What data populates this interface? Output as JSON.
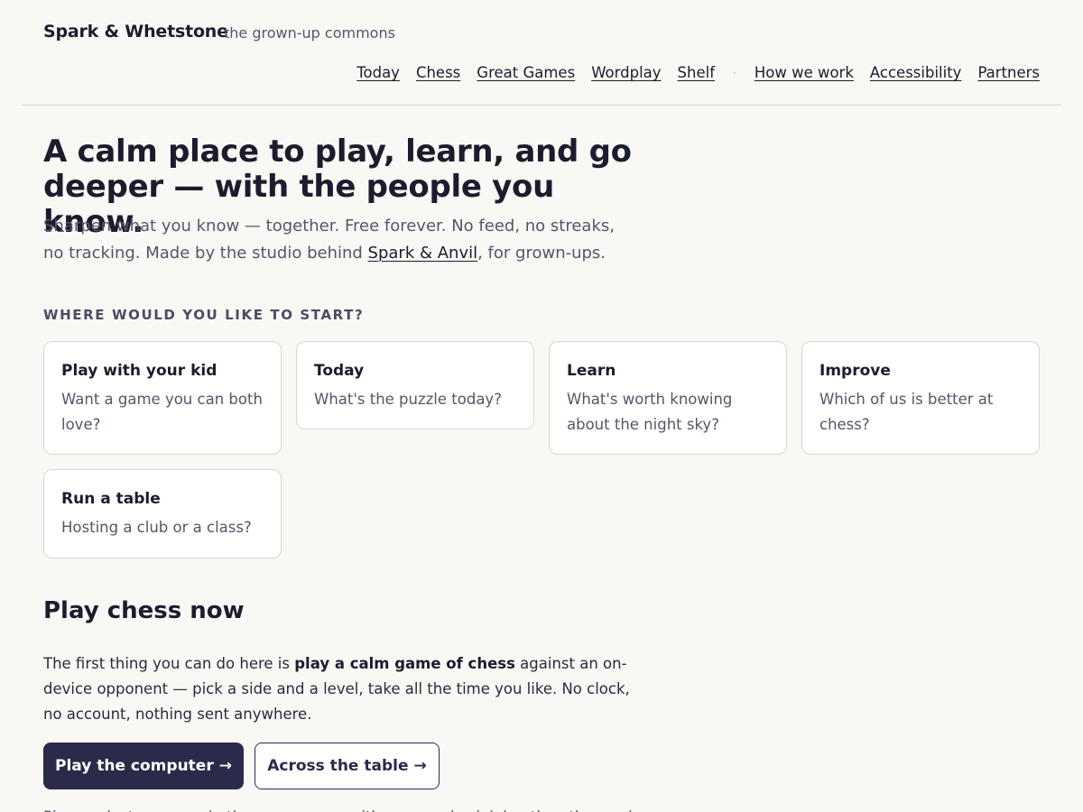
{
  "header": {
    "brand": "Spark & Whetstone",
    "tagline": "the grown-up commons",
    "nav": [
      {
        "label": "Today"
      },
      {
        "label": "Chess"
      },
      {
        "label": "Great Games"
      },
      {
        "label": "Wordplay"
      },
      {
        "label": "Shelf"
      }
    ],
    "nav_separator": "·",
    "nav_secondary": [
      {
        "label": "How we work"
      },
      {
        "label": "Accessibility"
      },
      {
        "label": "Partners"
      }
    ]
  },
  "hero": {
    "title": "A calm place to play, learn, and go deeper — with the people you know.",
    "subtitle_before": "Sharpen what you know — together. Free forever. No feed, no streaks, no tracking. Made by the studio behind ",
    "subtitle_link": "Spark & Anvil",
    "subtitle_after": ", for grown-ups."
  },
  "start": {
    "label": "WHERE WOULD YOU LIKE TO START?",
    "cards": [
      {
        "title": "Play with your kid",
        "desc": "Want a game you can both love?"
      },
      {
        "title": "Today",
        "desc": "What's the puzzle today?"
      },
      {
        "title": "Learn",
        "desc": "What's worth knowing about the night sky?"
      },
      {
        "title": "Improve",
        "desc": "Which of us is better at chess?"
      },
      {
        "title": "Run a table",
        "desc": "Hosting a club or a class?"
      }
    ]
  },
  "chess": {
    "heading": "Play chess now",
    "body_before": "The first thing you can do here is ",
    "body_bold": "play a calm game of chess",
    "body_after": " against an on-device opponent — pick a side and a level, take all the time you like. No clock, no account, nothing sent anywhere.",
    "primary_button": "Play the computer",
    "secondary_button": "Across the table",
    "arrow": "→",
    "next_line": "Play against a person in the same room, with no one else joining the other end."
  }
}
